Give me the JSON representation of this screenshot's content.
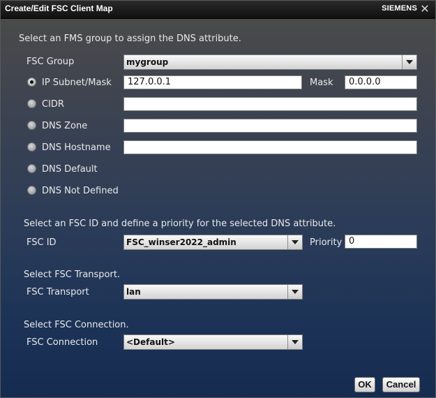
{
  "window": {
    "title": "Create/Edit FSC Client Map",
    "brand": "SIEMENS",
    "close_glyph": "✕"
  },
  "intro": "Select an FMS group to assign the DNS attribute.",
  "fsc_group": {
    "label": "FSC Group",
    "value": "mygroup"
  },
  "options": {
    "ip_subnet": {
      "label": "IP Subnet/Mask",
      "value": "127.0.0.1",
      "selected": true
    },
    "mask": {
      "label": "Mask",
      "value": "0.0.0.0"
    },
    "cidr": {
      "label": "CIDR",
      "value": ""
    },
    "dns_zone": {
      "label": "DNS Zone",
      "value": ""
    },
    "dns_hostname": {
      "label": "DNS Hostname",
      "value": ""
    },
    "dns_default": {
      "label": "DNS Default"
    },
    "dns_not_defined": {
      "label": "DNS Not Defined"
    }
  },
  "fsc_id_section": {
    "heading": "Select an FSC ID and define a priority for the selected DNS attribute.",
    "label": "FSC ID",
    "value": "FSC_winser2022_admin",
    "priority_label": "Priority",
    "priority_value": "0"
  },
  "transport_section": {
    "heading": "Select FSC Transport.",
    "label": "FSC Transport",
    "value": "lan"
  },
  "connection_section": {
    "heading": "Select FSC Connection.",
    "label": "FSC Connection",
    "value": "<Default>"
  },
  "buttons": {
    "ok": "OK",
    "cancel": "Cancel"
  }
}
